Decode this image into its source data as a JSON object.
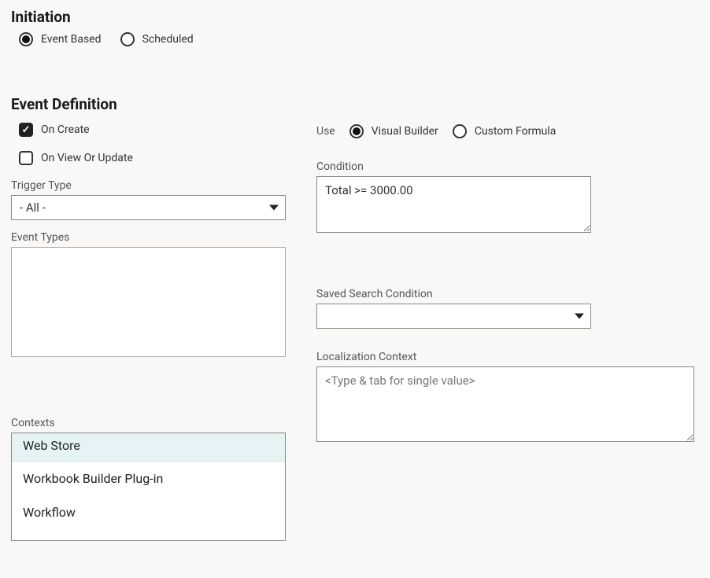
{
  "initiation": {
    "title": "Initiation",
    "options": {
      "event_based": "Event Based",
      "scheduled": "Scheduled"
    }
  },
  "event_definition": {
    "title": "Event Definition",
    "on_create": "On Create",
    "on_view_or_update": "On View Or Update",
    "trigger_type_label": "Trigger Type",
    "trigger_type_value": "- All -",
    "event_types_label": "Event Types",
    "contexts_label": "Contexts",
    "contexts_items": {
      "web_store": "Web Store",
      "workbook_plugin": "Workbook Builder Plug-in",
      "workflow": "Workflow"
    }
  },
  "use": {
    "label": "Use",
    "visual_builder": "Visual Builder",
    "custom_formula": "Custom Formula"
  },
  "condition": {
    "label": "Condition",
    "value": "Total >= 3000.00"
  },
  "saved_search": {
    "label": "Saved Search Condition",
    "value": ""
  },
  "localization": {
    "label": "Localization Context",
    "placeholder": "<Type & tab for single value>"
  }
}
